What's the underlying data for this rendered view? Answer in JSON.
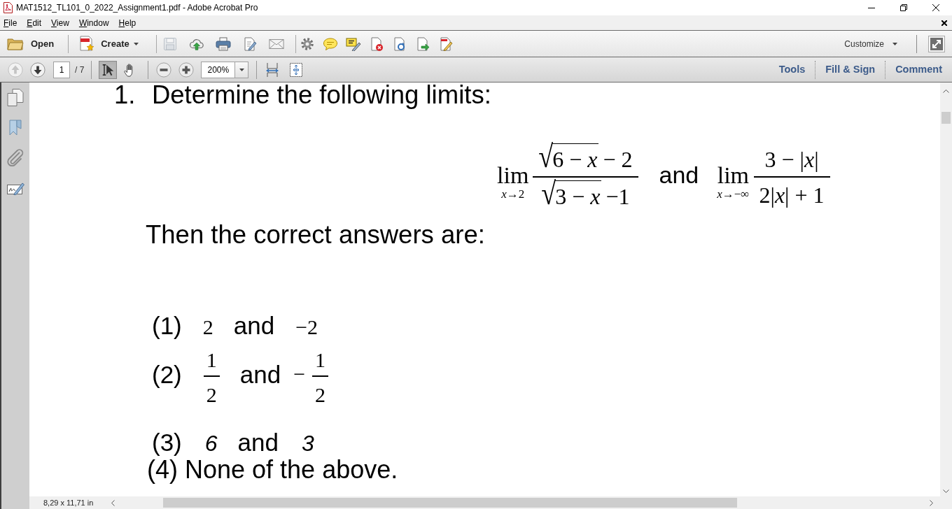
{
  "window": {
    "title": "MAT1512_TL101_0_2022_Assignment1.pdf - Adobe Acrobat Pro"
  },
  "menu": [
    {
      "label": "File"
    },
    {
      "label": "Edit"
    },
    {
      "label": "View"
    },
    {
      "label": "Window"
    },
    {
      "label": "Help"
    }
  ],
  "toolbar": {
    "open": "Open",
    "create": "Create",
    "quick_tool_groups": [
      {
        "tools": [
          {
            "disabled": true
          },
          {
            "disabled": false
          },
          {
            "disabled": false
          },
          {
            "disabled": false
          },
          {
            "disabled": false
          }
        ]
      },
      {
        "tools": [
          {
            "disabled": false
          },
          {
            "disabled": false
          },
          {
            "disabled": false
          },
          {
            "disabled": false
          },
          {
            "disabled": false
          },
          {
            "disabled": false
          },
          {
            "disabled": false
          }
        ]
      }
    ],
    "customize": "Customize"
  },
  "navigation": {
    "previous_disabled": true,
    "next_disabled": false,
    "page": "1",
    "page_count": "/ 7",
    "tools": [
      {
        "selected": true
      },
      {
        "selected": false
      }
    ],
    "zoom": "200%"
  },
  "panes": [
    {
      "label": "Tools"
    },
    {
      "label": "Fill & Sign"
    },
    {
      "label": "Comment"
    }
  ],
  "document": {
    "question": {
      "number": "1.",
      "text": "Determine the following limits:",
      "limits": [
        {
          "operator": "lim",
          "approach": "*x*→2",
          "numerator": {
            "radical": "√",
            "radicand": "6 − *x*",
            "rest": "− 2"
          },
          "denominator": {
            "radical": "√",
            "radicand": "3 − *x*",
            "rest": "−1"
          }
        },
        {
          "operator": "lim",
          "approach": "*x*→−∞",
          "numerator": {
            "text": "3 − |*x*|"
          },
          "denominator": {
            "text": "2|*x*| + 1"
          }
        }
      ],
      "conjunction": "and",
      "prompt": "Then the correct answers are:"
    },
    "answers": [
      {
        "kind": "choice",
        "label": "(1)",
        "parts": [
          {
            "kind": "number",
            "text": "2"
          },
          {
            "kind": "word",
            "text": "and"
          },
          {
            "kind": "number",
            "text": "−2"
          }
        ]
      },
      {
        "kind": "choice",
        "label": "(2)",
        "parts": [
          {
            "kind": "fraction",
            "numerator": "1",
            "denominator": "2"
          },
          {
            "kind": "word",
            "text": "and"
          },
          {
            "kind": "sign",
            "text": "−"
          },
          {
            "kind": "fraction",
            "numerator": "1",
            "denominator": "2"
          }
        ]
      },
      {
        "kind": "choice",
        "label": "(3)",
        "parts": [
          {
            "kind": "italic",
            "text": "6"
          },
          {
            "kind": "word",
            "text": "and"
          },
          {
            "kind": "italic",
            "text": "3"
          }
        ]
      },
      {
        "kind": "sentence",
        "text": "(4) None of the above."
      }
    ]
  },
  "status_bar": {
    "page_size": "8,29 x 11,71 in"
  }
}
